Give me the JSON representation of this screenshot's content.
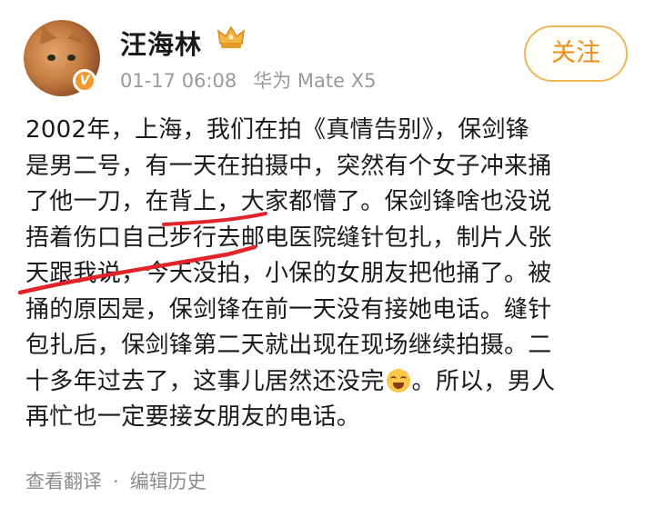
{
  "header": {
    "username": "汪海林",
    "timestamp": "01-17 06:08",
    "device": "华为 Mate X5",
    "follow_label": "关注",
    "verified_badge": "V",
    "avatar_icon": "cat-avatar",
    "crown_icon": "crown-icon"
  },
  "post": {
    "lines": [
      "2002年，上海，我们在拍《真情告别》，保剑锋",
      "是男二号，有一天在拍摄中，突然有个女子冲来捅",
      "了他一刀，在背上，大家都懵了。保剑锋啥也没说",
      "捂着伤口自己步行去邮电医院缝针包扎，制片人张",
      "天跟我说，今天没拍，小保的女朋友把他捅了。被",
      "捅的原因是，保剑锋在前一天没有接她电话。缝针",
      "包扎后，保剑锋第二天就出现在现场继续拍摄。二"
    ],
    "line8_before_emoji": "十多年过去了，这事儿居然还没完",
    "line8_emoji": "laughing-crying-emoji",
    "line8_after_emoji": "。所以，男人",
    "line9": "再忙也一定要接女朋友的电话。"
  },
  "footer": {
    "translate_label": "查看翻译",
    "separator": "·",
    "history_label": "编辑历史"
  },
  "colors": {
    "follow_accent": "#ee8d1c",
    "annotation_red": "#e0242a",
    "verified_orange": "#f29a2e"
  }
}
